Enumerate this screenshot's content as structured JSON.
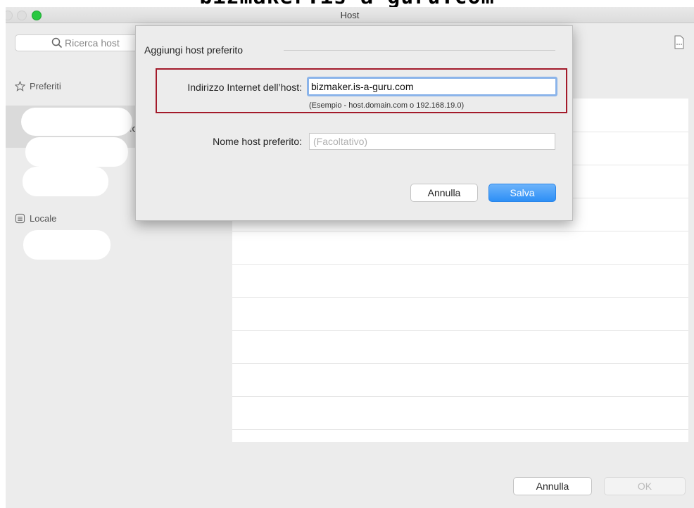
{
  "banner": {
    "text": "bizmaker.is-a-guru.com"
  },
  "window": {
    "title": "Host"
  },
  "sidebar": {
    "search_placeholder": "Ricerca host",
    "sections": [
      {
        "label": "Preferiti",
        "icon": "star-icon"
      },
      {
        "label": "Locale",
        "icon": "list-icon"
      }
    ],
    "selected_item_tail": ".c"
  },
  "dialog": {
    "title": "Aggiungi host preferito",
    "address_label": "Indirizzo Internet dell’host:",
    "address_value": "bizmaker.is-a-guru.com",
    "address_hint": "(Esempio - host.domain.com o 192.168.19.0)",
    "name_label": "Nome host preferito:",
    "name_placeholder": "(Facoltativo)",
    "cancel_label": "Annulla",
    "save_label": "Salva"
  },
  "footer": {
    "cancel_label": "Annulla",
    "ok_label": "OK"
  },
  "colors": {
    "accent": "#2d8ff6",
    "highlight_border": "#a31a2a",
    "focus_ring": "#8bb4ea",
    "maximize": "#28c840"
  }
}
